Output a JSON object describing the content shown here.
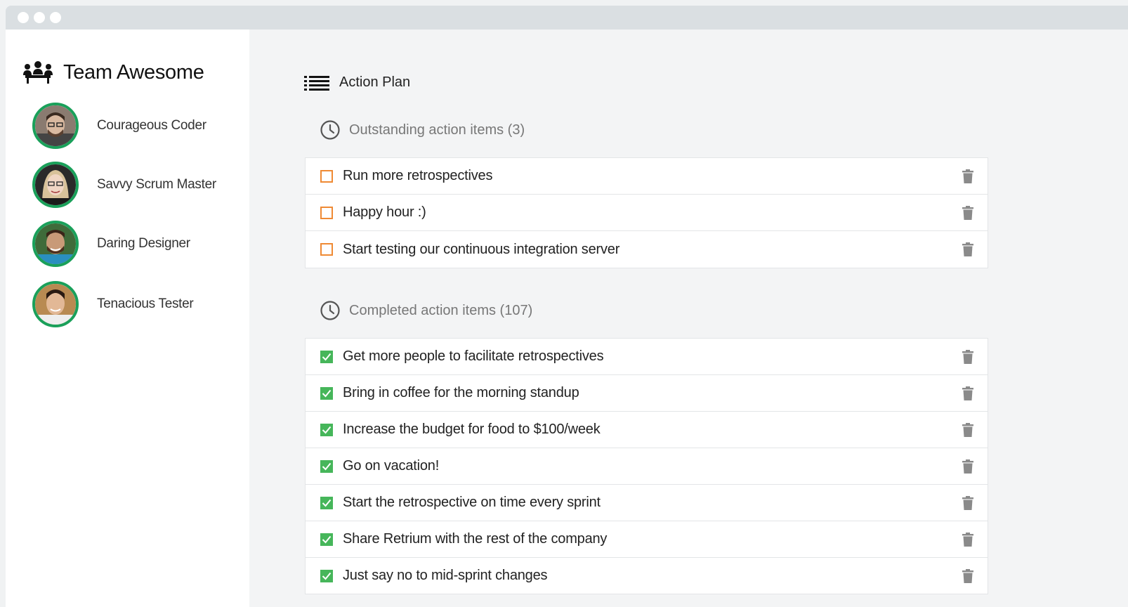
{
  "team": {
    "name": "Team Awesome",
    "members": [
      {
        "name": "Courageous Coder",
        "avatar": "avatar-coder"
      },
      {
        "name": "Savvy Scrum Master",
        "avatar": "avatar-scrum-master"
      },
      {
        "name": "Daring Designer",
        "avatar": "avatar-designer"
      },
      {
        "name": "Tenacious Tester",
        "avatar": "avatar-tester"
      }
    ]
  },
  "plan": {
    "title": "Action Plan",
    "outstanding": {
      "title": "Outstanding action items (3)",
      "items": [
        "Run more retrospectives",
        "Happy hour :)",
        "Start testing our continuous integration server"
      ]
    },
    "completed": {
      "title": "Completed action items (107)",
      "items": [
        "Get more people to facilitate retrospectives",
        "Bring in coffee for the morning standup",
        "Increase the budget for food to $100/week",
        "Go on vacation!",
        "Start the retrospective on time every sprint",
        "Share Retrium with the rest of the company",
        "Just say no to mid-sprint changes"
      ]
    }
  },
  "icons": {
    "team": "team-icon",
    "list": "list-icon",
    "clock": "clock-icon",
    "trash": "trash-icon",
    "checkbox_open": "checkbox-open-icon",
    "checkbox_done": "checkbox-checked-icon"
  },
  "colors": {
    "avatar_ring": "#1aa05a",
    "open_checkbox": "#ef8a34",
    "done_checkbox": "#46b65a",
    "muted_heading": "#777777",
    "trash_icon": "#8a8a8a"
  }
}
